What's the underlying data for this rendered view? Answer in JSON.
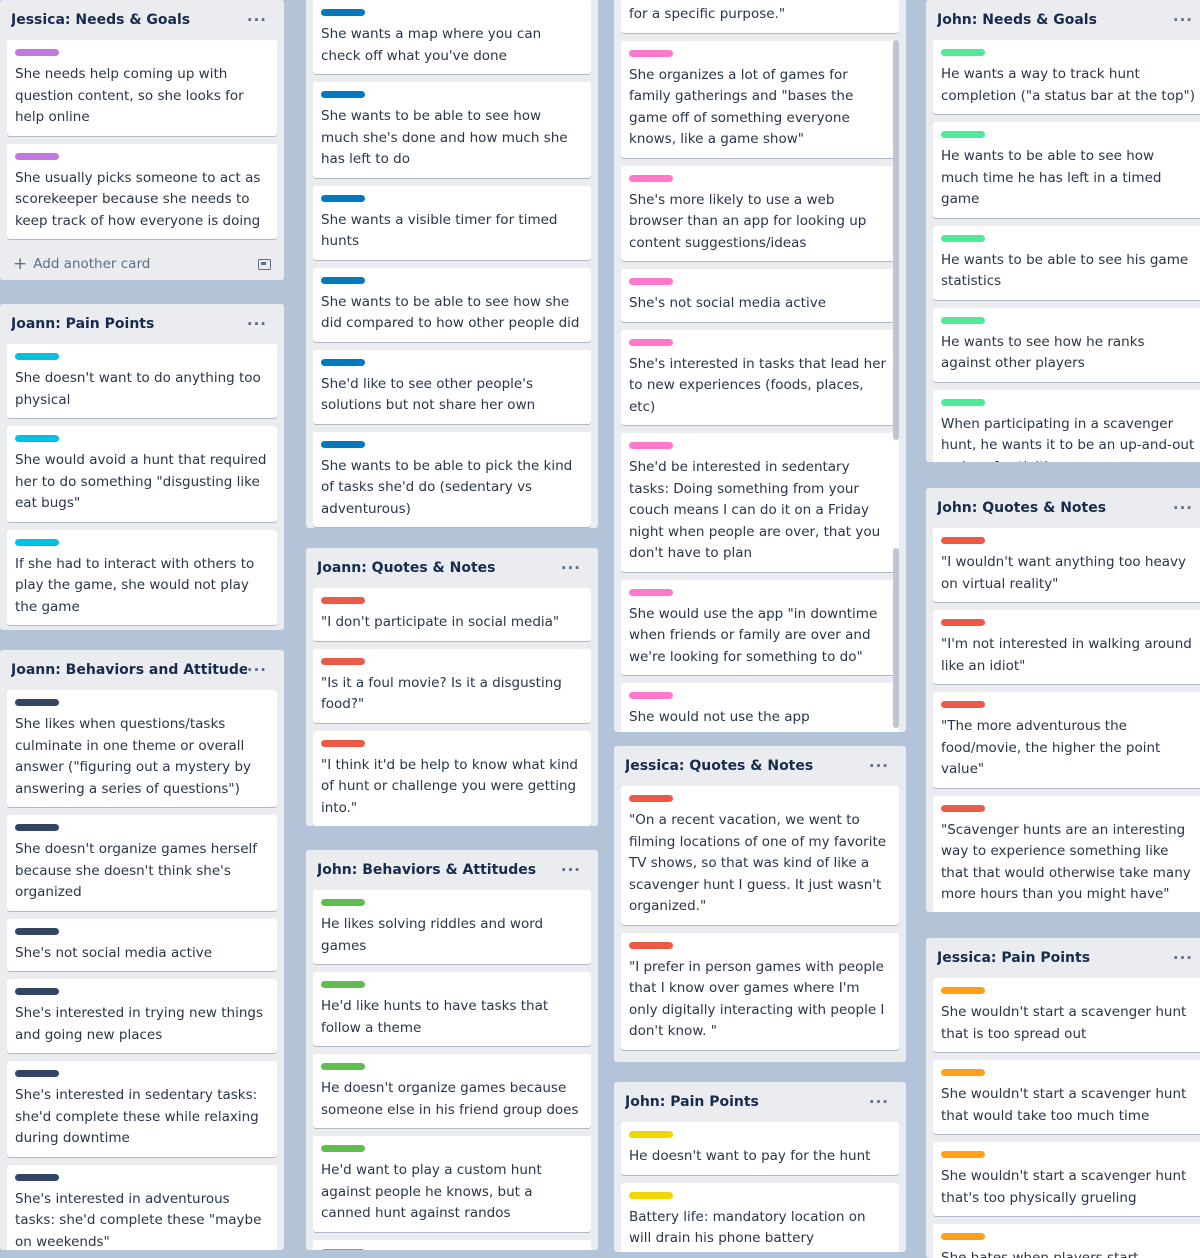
{
  "colors": {
    "purple": "#c377e0",
    "cyan": "#00c2e0",
    "navy": "#344563",
    "blue": "#0079bf",
    "red": "#eb5a46",
    "green": "#61bd4f",
    "pink": "#ff78cb",
    "mint": "#51e898",
    "orange": "#ff9f1a",
    "yellow": "#f2d600"
  },
  "menu_glyph": "···",
  "add_card_label": "Add another card",
  "lists": [
    {
      "title": "Jessica: Needs & Goals",
      "label": "purple",
      "cards": [
        "She needs help coming up with question content, so she looks for help online",
        "She usually picks someone to act as scorekeeper because she needs to keep track of how everyone is doing"
      ]
    },
    {
      "title": "Joann: Pain Points",
      "label": "cyan",
      "cards": [
        "She doesn't want to do anything too physical",
        "She would avoid a hunt that required her to do something \"disgusting like eat bugs\"",
        "If she had to interact with others to play the game, she would not play the game"
      ]
    },
    {
      "title": "Joann: Behaviors and Attitudes",
      "label": "navy",
      "cards": [
        "She likes when questions/tasks culminate in one theme or overall answer (\"figuring out a mystery by answering a series of questions\")",
        "She doesn't organize games herself because she doesn't think she's organized",
        "She's not social media active",
        "She's interested in trying new things and going new places",
        "She's interested in sedentary tasks: she'd complete these while relaxing during downtime",
        "She's interested in adventurous tasks: she'd complete these \"maybe on weekends\""
      ]
    },
    {
      "title": "",
      "label": "blue",
      "cards": [
        "She wants a map where you can check off what you've done",
        "She wants to be able to see how much she's done and how much she has left to do",
        "She wants a visible timer for timed hunts",
        "She wants to be able to see how she did compared to how other people did",
        "She'd like to see other people's solutions but not share her own",
        "She wants to be able to pick the kind of tasks she'd do (sedentary vs adventurous)"
      ]
    },
    {
      "title": "Joann: Quotes & Notes",
      "label": "red",
      "cards": [
        "\"I don't participate in social media\"",
        "\"Is it a foul movie? Is it a disgusting food?\"",
        "\"I think it'd be help to know what kind of hunt or challenge you were getting into.\""
      ]
    },
    {
      "title": "John: Behaviors & Attitudes",
      "label": "green",
      "cards": [
        "He likes solving riddles and word games",
        "He'd like hunts to have tasks that follow a theme",
        "He doesn't organize games because someone else in his friend group does",
        "He'd want to play a custom hunt against people he knows, but a canned hunt against randos",
        ""
      ]
    },
    {
      "title": "",
      "label": "pink",
      "top_text": "for a specific purpose.\"",
      "cards": [
        "She organizes a lot of games for family gatherings and \"bases the game off of something everyone knows, like a game show\"",
        "She's more likely to use a web browser than an app for looking up content suggestions/ideas",
        "She's not social media active",
        "She's interested in tasks that lead her to new experiences (foods, places, etc)",
        "She'd be interested in sedentary tasks: Doing something from your couch means I can do it on a Friday night when people are over, that you don't have to plan",
        "She would use the app \"in downtime when friends or family are over and we're looking for something to do\"",
        "She would not use the app individually"
      ]
    },
    {
      "title": "Jessica: Quotes & Notes",
      "label": "red",
      "cards": [
        "\"On a recent vacation, we went to filming locations of one of my favorite TV shows, so that was kind of like a scavenger hunt I guess. It just wasn't organized.\"",
        "\"I prefer in person games with people that I know over games where I'm only digitally interacting with people I don't know. \""
      ]
    },
    {
      "title": "John: Pain Points",
      "label": "yellow",
      "cards": [
        "He doesn't want to pay for the hunt",
        "Battery life: mandatory location on will drain his phone battery"
      ]
    },
    {
      "title": "John: Needs & Goals",
      "label": "mint",
      "cards": [
        "He wants a way to track hunt completion (\"a status bar at the top\")",
        "He wants to be able to see how much time he has left in a timed game",
        "He wants to be able to see his game statistics",
        "He wants to see how he ranks against other players",
        "When participating in a scavenger hunt, he wants it to be an up-and-out series of activities"
      ]
    },
    {
      "title": "John: Quotes & Notes",
      "label": "red",
      "cards": [
        "\"I wouldn't want anything too heavy on virtual reality\"",
        "\"I'm not interested in walking around like an idiot\"",
        "\"The more adventurous the food/movie, the higher the point value\"",
        "\"Scavenger hunts are an interesting way to experience something like that that would otherwise take many more hours than you might have\""
      ]
    },
    {
      "title": "Jessica: Pain Points",
      "label": "orange",
      "cards": [
        "She wouldn't start a scavenger hunt that is too spread out",
        "She wouldn't start a scavenger hunt that would take too much time",
        "She wouldn't start a scavenger hunt that's too physically grueling",
        "She hates when players start bickering"
      ]
    }
  ]
}
